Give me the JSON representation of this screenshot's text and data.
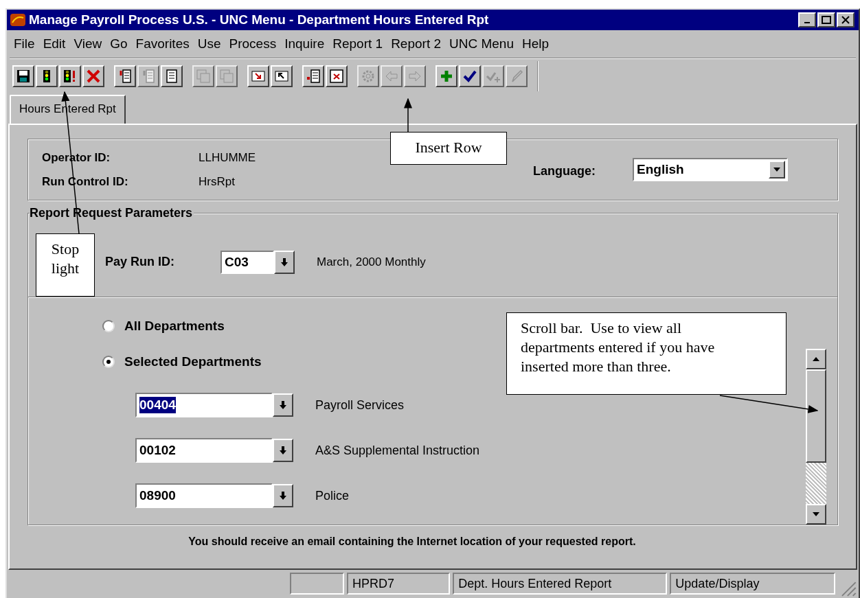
{
  "window": {
    "title": "Manage Payroll Process U.S. - UNC Menu - Department Hours Entered Rpt"
  },
  "menu": [
    "File",
    "Edit",
    "View",
    "Go",
    "Favorites",
    "Use",
    "Process",
    "Inquire",
    "Report 1",
    "Report 2",
    "UNC Menu",
    "Help"
  ],
  "toolbar": [
    [
      {
        "kind": "save",
        "disabled": false
      },
      {
        "kind": "run",
        "disabled": false
      },
      {
        "kind": "run-alert",
        "disabled": false
      },
      {
        "kind": "cancel",
        "disabled": false
      }
    ],
    [
      {
        "kind": "insert-doc",
        "disabled": false
      },
      {
        "kind": "insert-doc",
        "disabled": true
      },
      {
        "kind": "doc",
        "disabled": false
      }
    ],
    [
      {
        "kind": "windows",
        "disabled": true
      },
      {
        "kind": "windows",
        "disabled": true
      }
    ],
    [
      {
        "kind": "arrow-down-right",
        "disabled": false
      },
      {
        "kind": "arrow-up-left",
        "disabled": false
      }
    ],
    [
      {
        "kind": "insert-row",
        "disabled": false
      },
      {
        "kind": "delete-row",
        "disabled": false
      }
    ],
    [
      {
        "kind": "gear",
        "disabled": true
      },
      {
        "kind": "left",
        "disabled": true
      },
      {
        "kind": "right",
        "disabled": true
      }
    ],
    [
      {
        "kind": "plus",
        "disabled": false
      },
      {
        "kind": "check",
        "disabled": false
      },
      {
        "kind": "check-plus",
        "disabled": true
      },
      {
        "kind": "pencil",
        "disabled": true
      }
    ]
  ],
  "tabs": [
    {
      "label": "Hours Entered Rpt",
      "selected": true
    }
  ],
  "header": {
    "operator_label": "Operator ID:",
    "operator_value": "LLHUMME",
    "run_control_label": "Run Control ID:",
    "run_control_value": "HrsRpt",
    "language_label": "Language:",
    "language_value": "English"
  },
  "parameters": {
    "title": "Report Request Parameters",
    "pay_run_label": "Pay Run ID:",
    "pay_run_value": "C03",
    "pay_run_description": "March, 2000 Monthly",
    "options": [
      {
        "label": "All Departments",
        "selected": false
      },
      {
        "label": "Selected Departments",
        "selected": true
      }
    ],
    "departments": [
      {
        "value": "00404",
        "highlighted": true,
        "description": "Payroll Services"
      },
      {
        "value": "00102",
        "highlighted": false,
        "description": "A&S Supplemental Instruction"
      },
      {
        "value": "08900",
        "highlighted": false,
        "description": "Police"
      }
    ]
  },
  "message": "You should receive an email containing the Internet location of your requested report.",
  "status_bar": [
    "HPRD7",
    "Dept. Hours Entered Report",
    "Update/Display"
  ],
  "callouts": [
    {
      "kind": "stop-light",
      "text": "Stop light"
    },
    {
      "kind": "insert-row",
      "text": "Insert Row"
    },
    {
      "kind": "scroll-bar",
      "text": "Scroll bar.  Use to view all departments entered if you have inserted more than three."
    }
  ]
}
